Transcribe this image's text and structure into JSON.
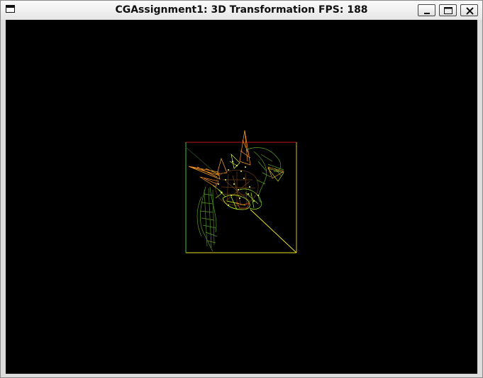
{
  "window": {
    "title": "CGAssignment1: 3D Transformation FPS: 188"
  },
  "titlebar_controls": {
    "system_menu_icon": "system-menu-icon",
    "minimize_icon": "minimize-icon",
    "maximize_icon": "maximize-icon",
    "close_icon": "close-icon"
  },
  "viewport": {
    "background": "#000000",
    "colors": {
      "box_edge_red": "#ff2020",
      "box_edge_green": "#40e040",
      "box_edge_yellow": "#ffff00",
      "mesh_green": "#6fbf20",
      "mesh_orange": "#ff9a20",
      "mesh_dark": "#6a3a10",
      "mesh_lime": "#c8ff20"
    }
  }
}
